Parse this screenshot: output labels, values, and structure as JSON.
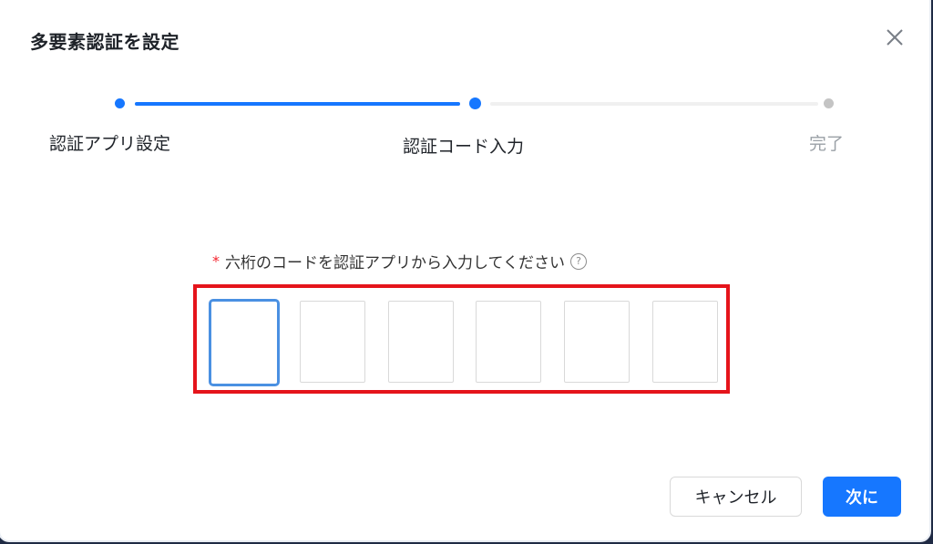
{
  "dialog": {
    "title": "多要素認証を設定",
    "close_icon": "close-icon"
  },
  "steps": [
    {
      "label": "認証アプリ設定",
      "status": "done"
    },
    {
      "label": "認証コード入力",
      "status": "current"
    },
    {
      "label": "完了",
      "status": "pending"
    }
  ],
  "form": {
    "required_mark": "*",
    "label": "六桁のコードを認証アプリから入力してください",
    "help_icon": "question-circle-icon",
    "code_boxes": [
      "",
      "",
      "",
      "",
      "",
      ""
    ]
  },
  "footer": {
    "cancel_label": "キャンセル",
    "next_label": "次に"
  },
  "colors": {
    "primary": "#1677ff",
    "active_border": "#4a90e2",
    "highlight": "#e5141b",
    "required": "#f5222d",
    "step_pending": "#c4c4c4"
  }
}
